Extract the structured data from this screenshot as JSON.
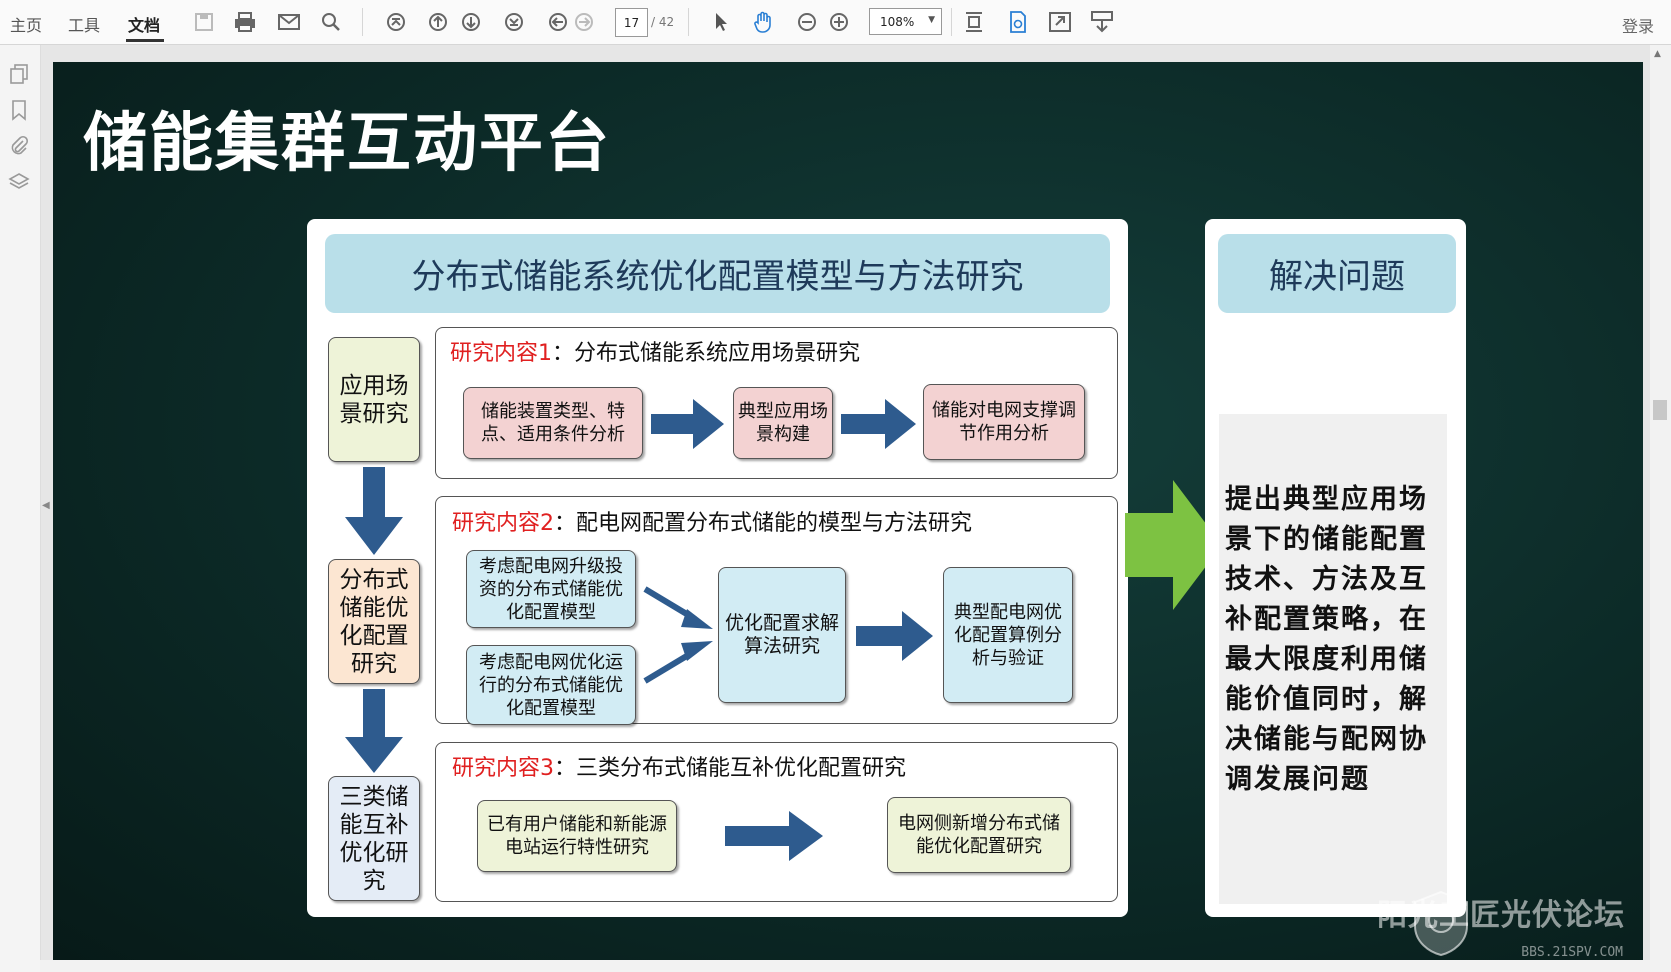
{
  "toolbar": {
    "menu": [
      "主页",
      "工具",
      "文档"
    ],
    "active_menu": "文档",
    "page_current": "17",
    "page_total": "/ 42",
    "zoom": "108%",
    "login": "登录"
  },
  "slide": {
    "title": "储能集群互动平台",
    "main_header": "分布式储能系统优化配置模型与方法研究",
    "stages": [
      "应用场景研究",
      "分布式储能优化配置研究",
      "三类储能互补优化研究"
    ],
    "research": [
      {
        "label": "研究内容1",
        "title": "：分布式储能系统应用场景研究",
        "boxes": [
          "储能装置类型、特点、适用条件分析",
          "典型应用场景构建",
          "储能对电网支撑调节作用分析"
        ]
      },
      {
        "label": "研究内容2",
        "title": "：配电网配置分布式储能的模型与方法研究",
        "boxes": [
          "考虑配电网升级投资的分布式储能优化配置模型",
          "考虑配电网优化运行的分布式储能优化配置模型",
          "优化配置求解算法研究",
          "典型配电网优化配置算例分析与验证"
        ]
      },
      {
        "label": "研究内容3",
        "title": "：三类分布式储能互补优化配置研究",
        "boxes": [
          "已有用户储能和新能源电站运行特性研究",
          "电网侧新增分布式储能优化配置研究"
        ]
      }
    ],
    "solution_header": "解决问题",
    "solution_text": "提出典型应用场景下的储能配置技术、方法及互补配置策略，在最大限度利用储能价值同时，解决储能与配网协调发展问题",
    "watermark": "阳光工匠光伏论坛",
    "watermark_sub": "BBS.21SPV.COM"
  },
  "colors": {
    "slide_bg": "#0c2a27",
    "header_bg": "#b9dfe9",
    "arrow_blue": "#2e5b8e",
    "arrow_green": "#7dc242",
    "label_red": "#e02020"
  }
}
